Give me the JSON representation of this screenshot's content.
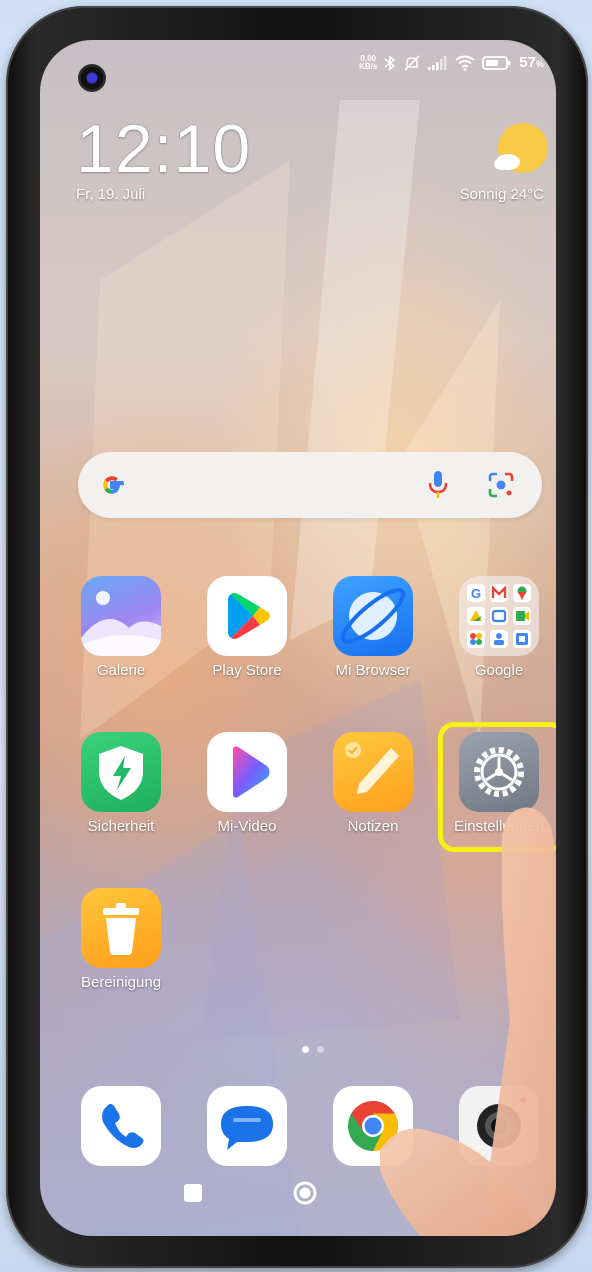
{
  "status_bar": {
    "net_speed_value": "0,00",
    "net_speed_unit": "KB/s",
    "battery": "57",
    "battery_unit": "%"
  },
  "lock": {
    "time": "12:10",
    "date": "Fr, 19. Juli",
    "weather": "Sonnig  24°C"
  },
  "apps_row1": [
    {
      "label": "Galerie",
      "icon": "gallery-icon"
    },
    {
      "label": "Play Store",
      "icon": "play-store-icon"
    },
    {
      "label": "Mi Browser",
      "icon": "mi-browser-icon"
    },
    {
      "label": "Google",
      "icon": "google-folder-icon"
    }
  ],
  "apps_row2": [
    {
      "label": "Sicherheit",
      "icon": "security-icon"
    },
    {
      "label": "Mi-Video",
      "icon": "mi-video-icon"
    },
    {
      "label": "Notizen",
      "icon": "notes-icon"
    },
    {
      "label": "Einstellungen",
      "icon": "settings-icon"
    }
  ],
  "apps_row3": [
    {
      "label": "Bereinigung",
      "icon": "cleaner-icon"
    }
  ],
  "dock": [
    {
      "icon": "phone-icon"
    },
    {
      "icon": "messages-icon"
    },
    {
      "icon": "chrome-icon"
    },
    {
      "icon": "camera-icon"
    }
  ],
  "highlight_color": "#f6f114",
  "page_indicator": {
    "pages": 2,
    "active": 1
  }
}
